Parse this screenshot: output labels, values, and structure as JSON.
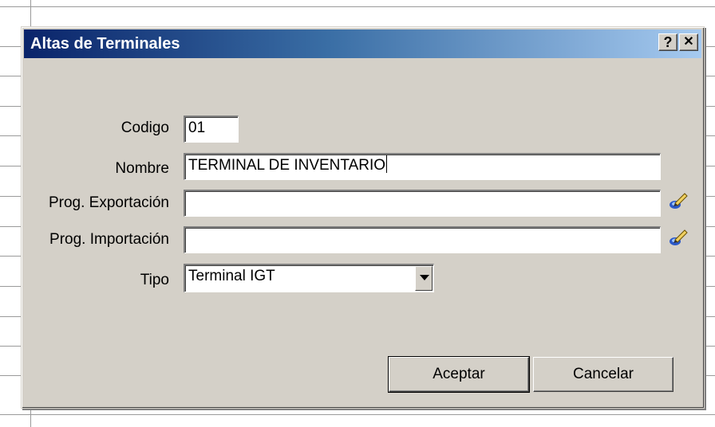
{
  "dialog": {
    "title": "Altas de Terminales",
    "help_label": "?",
    "close_label": "✕"
  },
  "form": {
    "codigo": {
      "label": "Codigo",
      "value": "01"
    },
    "nombre": {
      "label": "Nombre",
      "value": "TERMINAL DE INVENTARIO"
    },
    "prog_exportacion": {
      "label": "Prog. Exportación",
      "value": "",
      "browse_icon": "pencil-browse-icon"
    },
    "prog_importacion": {
      "label": "Prog. Importación",
      "value": "",
      "browse_icon": "pencil-browse-icon"
    },
    "tipo": {
      "label": "Tipo",
      "selected": "Terminal IGT"
    }
  },
  "buttons": {
    "aceptar": "Aceptar",
    "cancelar": "Cancelar"
  },
  "colors": {
    "titlebar_start": "#0a246a",
    "titlebar_end": "#a6caf0",
    "dialog_face": "#d4d0c8"
  }
}
